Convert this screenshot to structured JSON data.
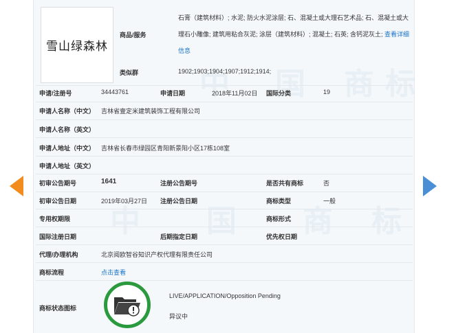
{
  "trademark": {
    "logo_text": "雪山绿森林",
    "goods_label": "商品/服务",
    "goods_text": "石膏（建筑材料）; 水泥; 防火水泥涂层; 石、混凝土或大理石艺术品; 石、混凝土或大理石小雕像; 建筑用粘合灰泥; 涂层（建筑材料）; 混凝土; 石英; 含钙泥灰土;",
    "goods_link": "查看详细信息",
    "similar_group_label": "类似群",
    "similar_group_value": "1902;1903;1904;1907;1912;1914;"
  },
  "fields": {
    "reg_no_label": "申请/注册号",
    "reg_no_value": "34443761",
    "apply_date_label": "申请日期",
    "apply_date_value": "2018年11月02日",
    "intl_class_label": "国际分类",
    "intl_class_value": "19",
    "applicant_cn_label": "申请人名称（中文）",
    "applicant_cn_value": "吉林省壹定米建筑装饰工程有限公司",
    "applicant_en_label": "申请人名称（英文）",
    "address_cn_label": "申请人地址（中文）",
    "address_cn_value": "吉林省长春市绿园区青阳新景阳小区17栋108室",
    "address_en_label": "申请人地址（英文）",
    "prelim_issue_label": "初审公告期号",
    "prelim_issue_value": "1641",
    "reg_issue_label": "注册公告期号",
    "shared_label": "是否共有商标",
    "shared_value": "否",
    "prelim_date_label": "初审公告日期",
    "prelim_date_value": "2019年03月27日",
    "reg_date_label": "注册公告日期",
    "mark_type_label": "商标类型",
    "mark_type_value": "一般",
    "exclusive_label": "专用权期限",
    "mark_form_label": "商标形式",
    "intl_reg_date_label": "国际注册日期",
    "later_date_label": "后期指定日期",
    "priority_date_label": "优先权日期",
    "agent_label": "代理/办理机构",
    "agent_value": "北京阅欧智谷知识产权代理有限责任公司",
    "process_label": "商标流程",
    "process_link": "点击查看",
    "status_label": "商标状态图标",
    "status_en": "LIVE/APPLICATION/Opposition Pending",
    "status_cn": "异议中"
  },
  "colors": {
    "accent_link": "#1a73c7",
    "status_ring": "#2b9a3e",
    "nav_left": "#f28c1e",
    "nav_right": "#4a8fd6"
  },
  "icons": {
    "status": "folder-warning-icon",
    "prev": "arrow-left-icon",
    "next": "arrow-right-icon"
  }
}
